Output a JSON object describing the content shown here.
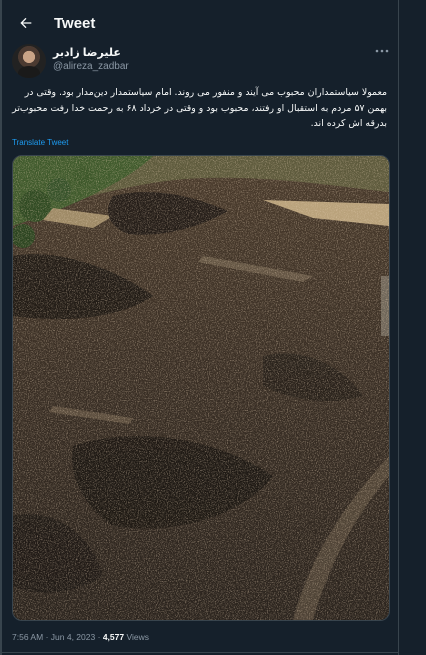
{
  "header": {
    "title": "Tweet",
    "back_icon": "arrow-left-icon"
  },
  "author": {
    "display_name": "علیرضا زادبر",
    "handle": "@alireza_zadbar"
  },
  "more_icon": "more-horizontal-icon",
  "tweet": {
    "text": "معمولا سیاستمداران محبوب می آیند و منفور می روند. امام سیاستمدار دین‌مدار بود. وقتی در بهمن ۵۷ مردم به استقبال او رفتند، محبوب بود و وقتی در خرداد ۶۸ به رحمت خدا رفت محبوب‌تر بدرقه اش کرده اند.",
    "translate_label": "Translate Tweet"
  },
  "meta": {
    "time": "7:56 AM",
    "separator": "·",
    "date": "Jun 4, 2023",
    "views_count": "4,577",
    "views_label": "Views"
  },
  "colors": {
    "background": "#15202b",
    "link": "#1d9bf0",
    "muted": "#8b98a5",
    "border": "#38444d"
  }
}
